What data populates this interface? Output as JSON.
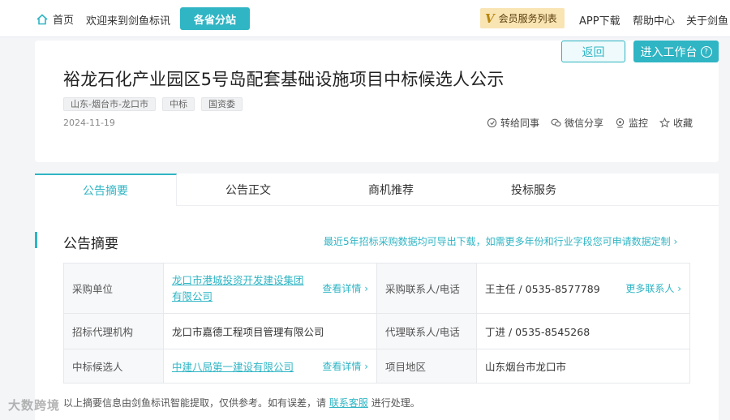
{
  "topbar": {
    "home": "首页",
    "welcome": "欢迎来到剑鱼标讯",
    "branch_button": "各省分站",
    "vip": "会员服务列表",
    "app": "APP下载",
    "help": "帮助中心",
    "about": "关于剑鱼"
  },
  "header": {
    "back": "返回",
    "workbench": "进入工作台",
    "title": "裕龙石化产业园区5号岛配套基础设施项目中标候选人公示",
    "tags": [
      "山东-烟台市-龙口市",
      "中标",
      "国资委"
    ],
    "date": "2024-11-19",
    "actions": [
      "转给同事",
      "微信分享",
      "监控",
      "收藏"
    ]
  },
  "tabs": [
    "公告摘要",
    "公告正文",
    "商机推荐",
    "投标服务"
  ],
  "summary": {
    "title": "公告摘要",
    "export_link": "最近5年招标采购数据均可导出下载，如需更多年份和行业字段您可申请数据定制 ›",
    "rows": [
      {
        "label": "采购单位",
        "value": "龙口市港城投资开发建设集团有限公司",
        "detail": "查看详情 ›",
        "label2": "采购联系人/电话",
        "value2": "王主任 / 0535-8577789",
        "more": "更多联系人 ›"
      },
      {
        "label": "招标代理机构",
        "value": "龙口市嘉德工程项目管理有限公司",
        "label2": "代理联系人/电话",
        "value2": "丁进 / 0535-8545268"
      },
      {
        "label": "中标候选人",
        "value": "中建八局第一建设有限公司",
        "detail": "查看详情 ›",
        "label2": "项目地区",
        "value2": "山东烟台市龙口市"
      }
    ],
    "footer_pre": "以上摘要信息由剑鱼标讯智能提取，仅供参考。如有误差，请",
    "footer_link": "联系客服",
    "footer_post": "进行处理。"
  },
  "watermark": "大数跨境"
}
